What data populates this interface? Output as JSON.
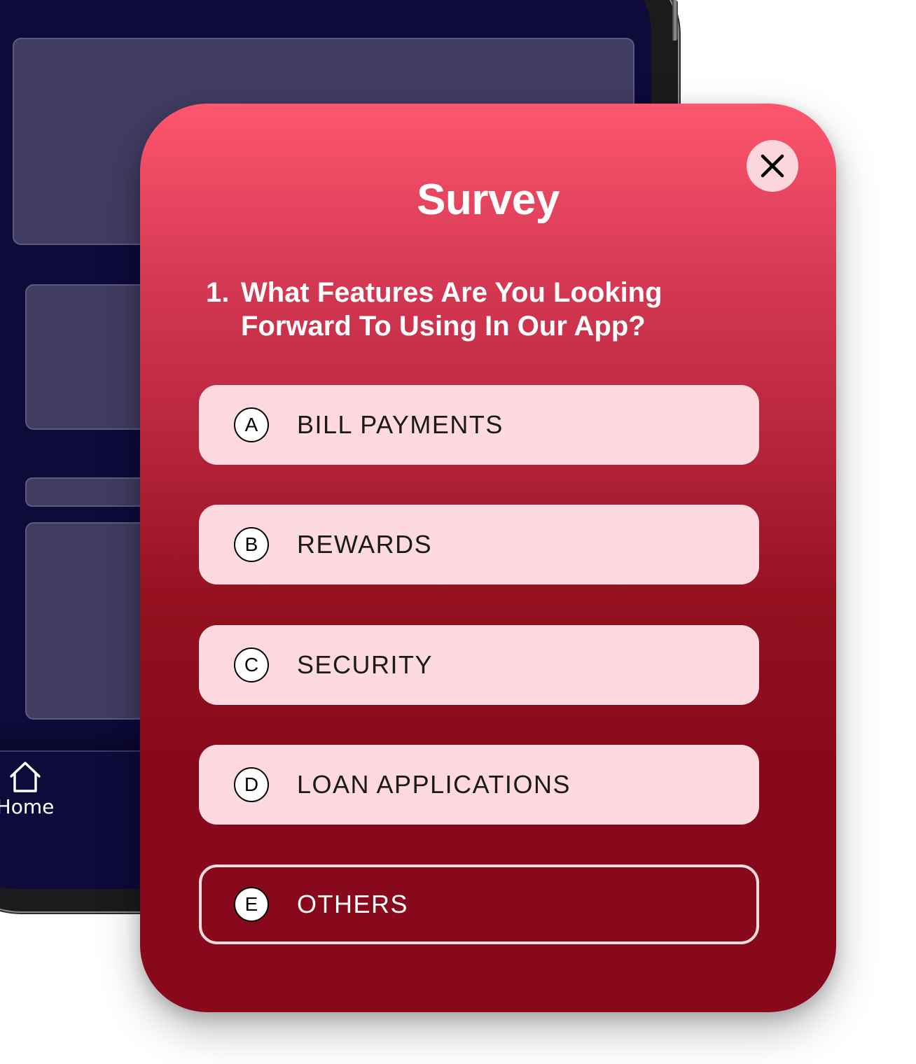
{
  "background_app": {
    "nav": {
      "home_label": "Home",
      "home_icon": "home-icon"
    }
  },
  "survey": {
    "title": "Survey",
    "close_icon": "close-icon",
    "question": {
      "number": "1.",
      "text": "What Features Are You Looking Forward To Using In Our App?"
    },
    "options": [
      {
        "letter": "A",
        "label": "BILL PAYMENTS",
        "selected": false
      },
      {
        "letter": "B",
        "label": "REWARDS",
        "selected": false
      },
      {
        "letter": "C",
        "label": "SECURITY",
        "selected": false
      },
      {
        "letter": "D",
        "label": "LOAN APPLICATIONS",
        "selected": false
      },
      {
        "letter": "E",
        "label": "OTHERS",
        "selected": true
      }
    ]
  },
  "colors": {
    "modal_top": "#fe566e",
    "modal_bottom": "#89091c",
    "option_bg": "#fed9df",
    "phone_bg": "#0e0a3a",
    "phone_card": "#413c62"
  }
}
